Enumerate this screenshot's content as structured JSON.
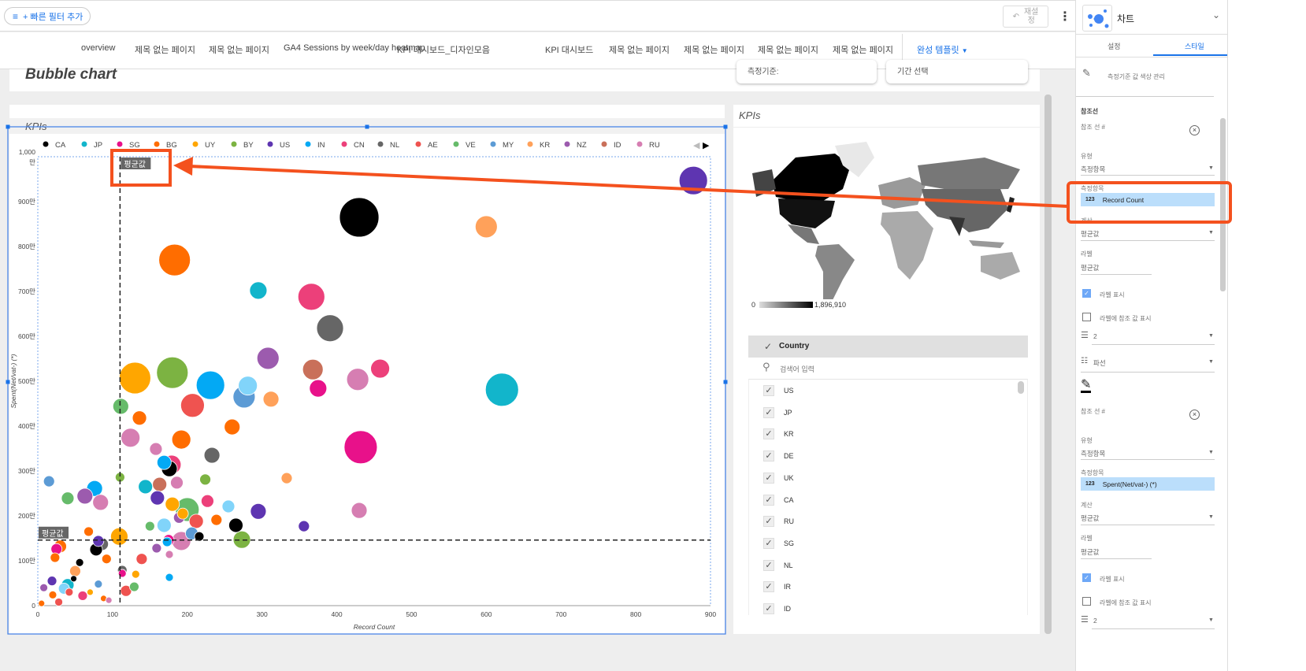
{
  "toolbar": {
    "filter_label": "+ 빠른 필터 추가",
    "reset_label": "재설\n정",
    "more_icon": "more-vert-icon"
  },
  "nav": {
    "tabs": [
      "overview",
      "제목 없는 페이지",
      "제목 없는 페이지",
      "GA4 Sessions by week/day heatmap",
      "KPI 대시보드_디자인모음",
      "KPI 대시보드",
      "제목 없는 페이지",
      "제목 없는 페이지",
      "제목 없는 페이지",
      "제목 없는 페이지"
    ],
    "active_tab": "완성 템플릿"
  },
  "page": {
    "title": "Bubble chart",
    "dropdown1": "측정기준:",
    "dropdown2": "기간 선택"
  },
  "bubble_panel": {
    "header": "KPIs"
  },
  "map_panel": {
    "header": "KPIs",
    "legend_min": "0",
    "legend_max": "1,896,910"
  },
  "filter": {
    "header": "Country",
    "search_placeholder": "검색어 입력",
    "items": [
      "US",
      "JP",
      "KR",
      "DE",
      "UK",
      "CA",
      "RU",
      "SG",
      "NL",
      "IR",
      "ID"
    ]
  },
  "chart_data": {
    "type": "scatter",
    "subtype": "bubble",
    "xlabel": "Record Count",
    "ylabel": "Spent(Net/vat-) (*)",
    "xlim": [
      0,
      900
    ],
    "ylim": [
      0,
      1000
    ],
    "xticks": [
      "0",
      "100",
      "200",
      "300",
      "400",
      "500",
      "600",
      "700",
      "800",
      "900"
    ],
    "yticks": [
      "0",
      "100만",
      "200만",
      "300만",
      "400만",
      "500만",
      "600만",
      "700만",
      "800만",
      "900만",
      "1,000\n만"
    ],
    "legend_position": "top",
    "legend": [
      {
        "name": "CA",
        "color": "#000000"
      },
      {
        "name": "JP",
        "color": "#12B5CB"
      },
      {
        "name": "SG",
        "color": "#E8118A"
      },
      {
        "name": "BG",
        "color": "#FF6D00"
      },
      {
        "name": "UY",
        "color": "#FFA600"
      },
      {
        "name": "BY",
        "color": "#7CB342"
      },
      {
        "name": "US",
        "color": "#5E35B1"
      },
      {
        "name": "IN",
        "color": "#03A9F4"
      },
      {
        "name": "CN",
        "color": "#EC407A"
      },
      {
        "name": "NL",
        "color": "#666666"
      },
      {
        "name": "AE",
        "color": "#EF5350"
      },
      {
        "name": "VE",
        "color": "#66BB6A"
      },
      {
        "name": "MY",
        "color": "#5C9BD5"
      },
      {
        "name": "KR",
        "color": "#FFA15A"
      },
      {
        "name": "NZ",
        "color": "#9C5BAE"
      },
      {
        "name": "ID",
        "color": "#C9705A"
      },
      {
        "name": "RU",
        "color": "#D67EB2"
      }
    ],
    "reference_lines": [
      {
        "axis": "x",
        "value": 110,
        "label": "평균값"
      },
      {
        "axis": "y",
        "value": 146,
        "label": "평균값"
      }
    ],
    "points": [
      [
        877,
        947,
        324,
        "US"
      ],
      [
        430,
        865,
        625,
        "CA"
      ],
      [
        600,
        844,
        196,
        "KR"
      ],
      [
        183,
        770,
        400,
        "BG"
      ],
      [
        295,
        702,
        121,
        "JP"
      ],
      [
        366,
        688,
        289,
        "CN"
      ],
      [
        391,
        618,
        289,
        "NL"
      ],
      [
        308,
        551,
        196,
        "NZ"
      ],
      [
        458,
        528,
        144,
        "CN"
      ],
      [
        130,
        507,
        400,
        "UY"
      ],
      [
        180,
        519,
        400,
        "BY"
      ],
      [
        281,
        490,
        144,
        "#81D4FA"
      ],
      [
        231,
        491,
        324,
        "IN"
      ],
      [
        368,
        526,
        169,
        "ID"
      ],
      [
        276,
        465,
        196,
        "MY"
      ],
      [
        312,
        460,
        100,
        "KR"
      ],
      [
        375,
        484,
        121,
        "SG"
      ],
      [
        428,
        504,
        196,
        "RU"
      ],
      [
        207,
        446,
        225,
        "AE"
      ],
      [
        111,
        444,
        100,
        "VE"
      ],
      [
        621,
        481,
        441,
        "JP"
      ],
      [
        136,
        418,
        81,
        "BG"
      ],
      [
        124,
        374,
        144,
        "RU"
      ],
      [
        192,
        370,
        144,
        "BG"
      ],
      [
        260,
        398,
        100,
        "BG"
      ],
      [
        432,
        353,
        441,
        "SG"
      ],
      [
        233,
        335,
        100,
        "NL"
      ],
      [
        158,
        349,
        64,
        "RU"
      ],
      [
        179,
        314,
        144,
        "CN"
      ],
      [
        176,
        305,
        100,
        "CA"
      ],
      [
        169,
        319,
        81,
        "IN"
      ],
      [
        15,
        277,
        49,
        "MY"
      ],
      [
        110,
        286,
        36,
        "BY"
      ],
      [
        76,
        261,
        100,
        "IN"
      ],
      [
        144,
        265,
        81,
        "JP"
      ],
      [
        163,
        270,
        81,
        "ID"
      ],
      [
        186,
        274,
        64,
        "RU"
      ],
      [
        224,
        281,
        49,
        "BY"
      ],
      [
        333,
        284,
        49,
        "KR"
      ],
      [
        40,
        239,
        64,
        "VE"
      ],
      [
        63,
        244,
        100,
        "NZ"
      ],
      [
        84,
        230,
        100,
        "RU"
      ],
      [
        160,
        240,
        81,
        "US"
      ],
      [
        180,
        226,
        81,
        "UY"
      ],
      [
        200,
        214,
        225,
        "VE"
      ],
      [
        227,
        233,
        64,
        "CN"
      ],
      [
        255,
        221,
        64,
        "#81D4FA"
      ],
      [
        430,
        212,
        100,
        "RU"
      ],
      [
        295,
        210,
        100,
        "US"
      ],
      [
        189,
        196,
        49,
        "NZ"
      ],
      [
        194,
        205,
        49,
        "UY"
      ],
      [
        212,
        188,
        81,
        "AE"
      ],
      [
        239,
        191,
        49,
        "BG"
      ],
      [
        169,
        179,
        81,
        "#81D4FA"
      ],
      [
        356,
        177,
        49,
        "US"
      ],
      [
        265,
        179,
        81,
        "CA"
      ],
      [
        273,
        147,
        121,
        "BY"
      ],
      [
        216,
        154,
        36,
        "CA"
      ],
      [
        206,
        161,
        64,
        "MY"
      ],
      [
        150,
        177,
        36,
        "VE"
      ],
      [
        192,
        144,
        144,
        "RU"
      ],
      [
        109,
        154,
        121,
        "UY"
      ],
      [
        68,
        165,
        36,
        "BG"
      ],
      [
        17,
        163,
        49,
        "JP"
      ],
      [
        30,
        132,
        64,
        "BG"
      ],
      [
        81,
        144,
        49,
        "US"
      ],
      [
        86,
        137,
        64,
        "NL"
      ],
      [
        78,
        125,
        64,
        "CA"
      ],
      [
        175,
        146,
        49,
        "SG"
      ],
      [
        173,
        142,
        36,
        "IN"
      ],
      [
        159,
        128,
        36,
        "NZ"
      ],
      [
        176,
        114,
        25,
        "RU"
      ],
      [
        92,
        104,
        36,
        "BG"
      ],
      [
        25,
        126,
        49,
        "SG"
      ],
      [
        23,
        107,
        36,
        "BG"
      ],
      [
        139,
        104,
        49,
        "AE"
      ],
      [
        50,
        77,
        49,
        "KR"
      ],
      [
        56,
        96,
        25,
        "CA"
      ],
      [
        40,
        46,
        64,
        "JP"
      ],
      [
        81,
        48,
        25,
        "MY"
      ],
      [
        113,
        72,
        25,
        "SG"
      ],
      [
        88,
        16,
        16,
        "BG"
      ],
      [
        118,
        33,
        49,
        "AE"
      ],
      [
        129,
        42,
        36,
        "VE"
      ],
      [
        131,
        70,
        25,
        "UY"
      ],
      [
        176,
        63,
        25,
        "IN"
      ],
      [
        113,
        79,
        36,
        "NL"
      ],
      [
        19,
        55,
        36,
        "US"
      ],
      [
        8,
        40,
        25,
        "NZ"
      ],
      [
        20,
        24,
        25,
        "BG"
      ],
      [
        60,
        22,
        36,
        "CN"
      ],
      [
        42,
        30,
        25,
        "AE"
      ],
      [
        5,
        5,
        16,
        "BG"
      ],
      [
        28,
        8,
        25,
        "AE"
      ],
      [
        70,
        30,
        16,
        "UY"
      ],
      [
        95,
        12,
        16,
        "RU"
      ],
      [
        48,
        60,
        16,
        "CA"
      ],
      [
        35,
        38,
        49,
        "#81D4FA"
      ]
    ]
  },
  "right_panel": {
    "title": "차트",
    "tabs": [
      "설정",
      "스타일"
    ],
    "active_tab": "스타일",
    "color_manage": "측정기준 값 색상 관리",
    "section": "참조선",
    "refs": [
      {
        "header": "참조 선 #",
        "type_label": "유형",
        "type_value": "측정항목",
        "metric_label": "측정항목",
        "metric_value": "Record Count",
        "metric_badge": "123",
        "calc_label": "계산",
        "calc_value": "평균값",
        "label_label": "라벨",
        "label_value": "평균값",
        "show_label": "라벨 표시",
        "show_label_checked": true,
        "show_ref": "라벨에 참조 값 표시",
        "show_ref_checked": false,
        "weight": "2",
        "style": "파선"
      },
      {
        "header": "참조 선 #",
        "type_label": "유형",
        "type_value": "측정항목",
        "metric_label": "측정항목",
        "metric_value": "Spent(Net/vat-) (*)",
        "metric_badge": "123",
        "calc_label": "계산",
        "calc_value": "평균값",
        "label_label": "라벨",
        "label_value": "평균값",
        "show_label": "라벨 표시",
        "show_label_checked": true,
        "show_ref": "라벨에 참조 값 표시",
        "show_ref_checked": false,
        "weight": "2"
      }
    ]
  },
  "annotation_color": "#F4511E"
}
